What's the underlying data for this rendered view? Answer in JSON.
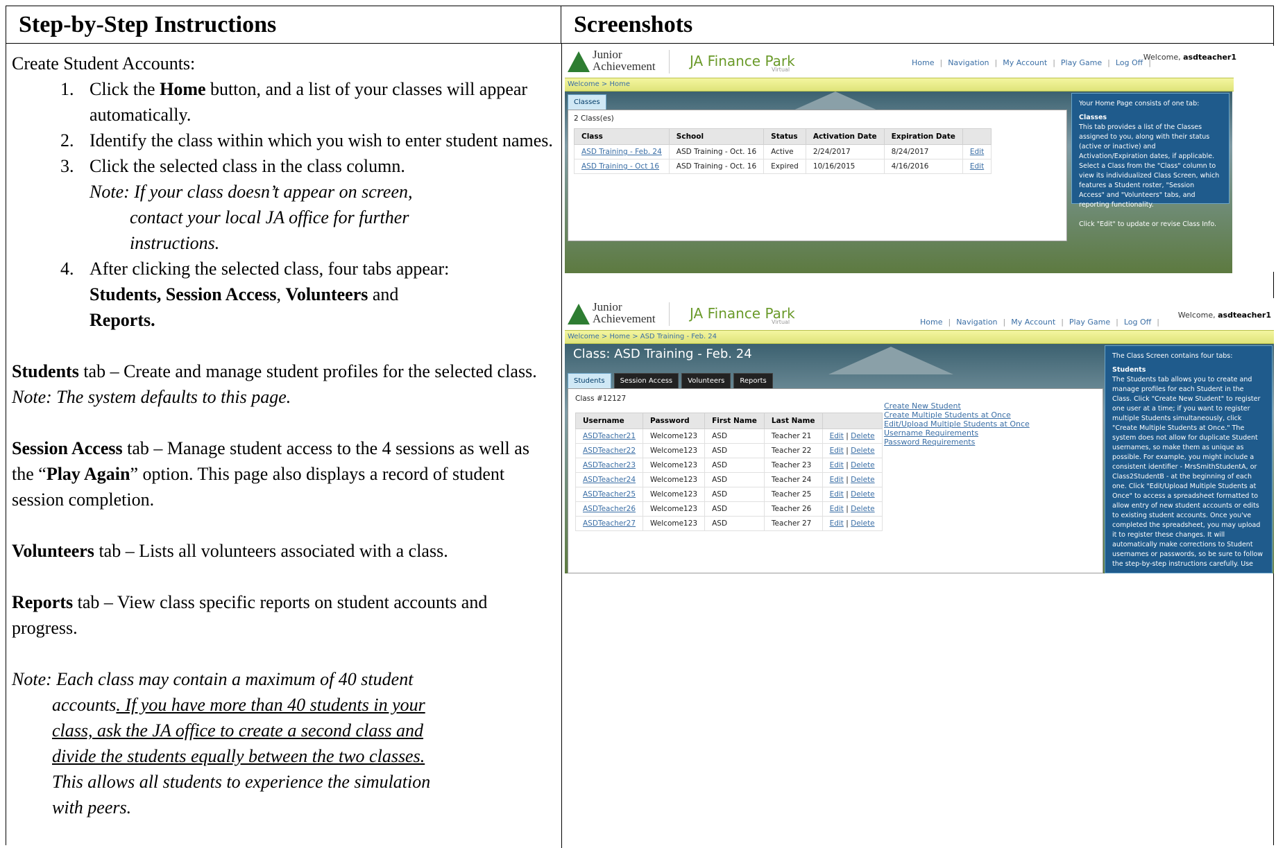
{
  "headers": {
    "left": "Step-by-Step Instructions",
    "right": "Screenshots"
  },
  "instructions": {
    "intro": "Create Student Accounts:",
    "steps": [
      {
        "num": "1.",
        "pre": "Click the ",
        "bold": "Home",
        "post": " button, and a list of your classes will appear automatically."
      },
      {
        "num": "2.",
        "text": "Identify the class within which you wish to enter student names."
      },
      {
        "num": "3.",
        "text": "Click the selected class in the class column."
      },
      {
        "num": "4.",
        "text": "After clicking the selected class, four tabs appear:"
      }
    ],
    "step3_note_a": "Note: If your class doesn’t appear on screen,",
    "step3_note_b": "contact your local JA office for further",
    "step3_note_c": "instructions.",
    "step4_tabs": {
      "a": "Students, Session Access",
      "b": "Volunteers",
      "c": "Reports.",
      "and1": ", ",
      "and2": " and"
    },
    "students": {
      "bold": "Students",
      "text": " tab – Create and manage student profiles for the selected class.",
      "note": "Note: The system defaults to this page."
    },
    "session": {
      "bold": "Session Access",
      "text1": " tab – Manage student access to the 4 sessions as well as the “",
      "play": "Play Again",
      "text2": "” option. This page also displays a record of student session completion."
    },
    "volunteers": {
      "bold": "Volunteers",
      "text": " tab – Lists all volunteers associated with a class."
    },
    "reports": {
      "bold": "Reports",
      "text": " tab – View class specific reports on student accounts and progress."
    },
    "final_note": {
      "a": "Note: Each class may contain a maximum of 40 student",
      "b": "accounts",
      "c": ". If you have more than 40 students in your",
      "d": "class, ask the JA office to create a second class and",
      "e": "divide the students equally between the two classes.",
      "f": "This allows all students to experience the simulation",
      "g": "with peers."
    }
  },
  "app": {
    "logo_line1": "Junior",
    "logo_line2": "Achievement",
    "brand": "JA Finance Park",
    "brand_sub": "Virtual",
    "nav": [
      "Home",
      "Navigation",
      "My Account",
      "Play Game",
      "Log Off"
    ],
    "welcome": "Welcome,",
    "user": "asdteacher1"
  },
  "shot1": {
    "crumb": "Welcome > Home",
    "tab": "Classes",
    "count": "2 Class(es)",
    "columns": [
      "Class",
      "School",
      "Status",
      "Activation Date",
      "Expiration Date",
      ""
    ],
    "rows": [
      [
        "ASD Training - Feb. 24",
        "ASD Training - Oct. 16",
        "Active",
        "2/24/2017",
        "8/24/2017",
        "Edit"
      ],
      [
        "ASD Training - Oct 16",
        "ASD Training - Oct. 16",
        "Expired",
        "10/16/2015",
        "4/16/2016",
        "Edit"
      ]
    ],
    "help_title": "Your Home Page consists of one tab:",
    "help_head": "Classes",
    "help_body": "This tab provides a list of the Classes assigned to you, along with their status (active or inactive) and Activation/Expiration dates, if applicable. Select a Class from the \"Class\" column to view its individualized Class Screen, which features a Student roster, \"Session Access\" and \"Volunteers\" tabs, and reporting functionality.",
    "help_foot": "Click \"Edit\" to update or revise Class Info."
  },
  "shot2": {
    "crumb": "Welcome > Home > ASD Training - Feb. 24",
    "title": "Class: ASD Training - Feb. 24",
    "tabs": [
      "Students",
      "Session Access",
      "Volunteers",
      "Reports"
    ],
    "classno": "Class #12127",
    "columns": [
      "Username",
      "Password",
      "First Name",
      "Last Name",
      ""
    ],
    "rows": [
      [
        "ASDTeacher21",
        "Welcome123",
        "ASD",
        "Teacher 21"
      ],
      [
        "ASDTeacher22",
        "Welcome123",
        "ASD",
        "Teacher 22"
      ],
      [
        "ASDTeacher23",
        "Welcome123",
        "ASD",
        "Teacher 23"
      ],
      [
        "ASDTeacher24",
        "Welcome123",
        "ASD",
        "Teacher 24"
      ],
      [
        "ASDTeacher25",
        "Welcome123",
        "ASD",
        "Teacher 25"
      ],
      [
        "ASDTeacher26",
        "Welcome123",
        "ASD",
        "Teacher 26"
      ],
      [
        "ASDTeacher27",
        "Welcome123",
        "ASD",
        "Teacher 27"
      ]
    ],
    "edit": "Edit",
    "pipe": "|",
    "delete": "Delete",
    "links": [
      "Create New Student",
      "Create Multiple Students at Once",
      "Edit/Upload Multiple Students at Once",
      "Username Requirements",
      "Password Requirements"
    ],
    "help_title": "The Class Screen contains four tabs:",
    "help_head": "Students",
    "help_body": "The Students tab allows you to create and manage profiles for each Student in the Class. Click \"Create New Student\" to register one user at a time; if you want to register multiple Students simultaneously, click \"Create Multiple Students at Once.\" The system does not allow for duplicate Student usernames, so make them as unique as possible. For example, you might include a consistent identifier - MrsSmithStudentA, or Class2StudentB - at the beginning of each one. Click \"Edit/Upload Multiple Students at Once\" to access a spreadsheet formatted to allow entry of new student accounts or edits to existing student accounts. Once you've completed the spreadsheet, you may upload it to register these changes. It will automatically make corrections to Student usernames or passwords, so be sure to follow the step-by-step instructions carefully. Use"
  }
}
